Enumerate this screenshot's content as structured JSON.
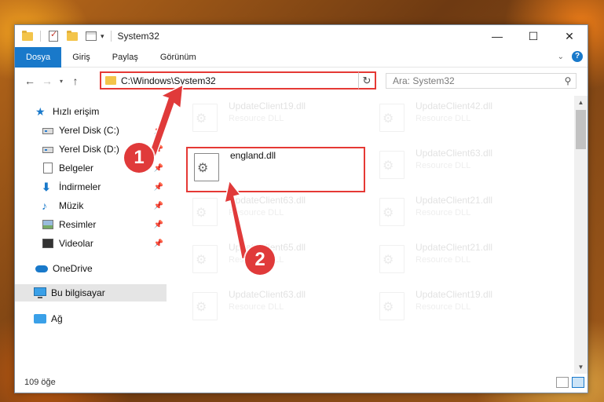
{
  "window": {
    "title": "System32",
    "controls": {
      "minimize": "—",
      "maximize": "☐",
      "close": "✕"
    }
  },
  "ribbon": {
    "tabs": [
      "Dosya",
      "Giriş",
      "Paylaş",
      "Görünüm"
    ],
    "active_tab": "Dosya"
  },
  "navigation": {
    "address": "C:\\Windows\\System32",
    "search_placeholder": "Ara: System32"
  },
  "sidebar": {
    "items": [
      {
        "label": "Hızlı erişim",
        "icon": "star-icon"
      },
      {
        "label": "Yerel Disk (C:)",
        "icon": "drive-icon",
        "pinned": true
      },
      {
        "label": "Yerel Disk (D:)",
        "icon": "drive-icon",
        "pinned": true
      },
      {
        "label": "Belgeler",
        "icon": "documents-icon",
        "pinned": true
      },
      {
        "label": "İndirmeler",
        "icon": "download-icon",
        "pinned": true
      },
      {
        "label": "Müzik",
        "icon": "music-icon",
        "pinned": true
      },
      {
        "label": "Resimler",
        "icon": "pictures-icon",
        "pinned": true
      },
      {
        "label": "Videolar",
        "icon": "videos-icon",
        "pinned": true
      },
      {
        "label": "OneDrive",
        "icon": "onedrive-icon"
      },
      {
        "label": "Bu bilgisayar",
        "icon": "this-pc-icon",
        "selected": true
      },
      {
        "label": "Ağ",
        "icon": "network-icon"
      }
    ]
  },
  "files": {
    "column1": [
      {
        "name": "UpdateClient19.dll",
        "type": "Resource DLL"
      },
      {
        "name": "england.dll",
        "type": ""
      },
      {
        "name": "UpdateClient63.dll",
        "type": "Resource DLL"
      },
      {
        "name": "UpdateClient65.dll",
        "type": "Resource DLL"
      },
      {
        "name": "UpdateClient63.dll",
        "type": "Resource DLL"
      }
    ],
    "column2": [
      {
        "name": "UpdateClient42.dll",
        "type": "Resource DLL"
      },
      {
        "name": "UpdateClient63.dll",
        "type": "Resource DLL"
      },
      {
        "name": "UpdateClient21.dll",
        "type": "Resource DLL"
      },
      {
        "name": "UpdateClient21.dll",
        "type": "Resource DLL"
      },
      {
        "name": "UpdateClient19.dll",
        "type": "Resource DLL"
      }
    ]
  },
  "status": {
    "item_count": "109 öğe"
  },
  "annotations": {
    "marker1": "1",
    "marker2": "2",
    "color": "#e03a3a"
  }
}
